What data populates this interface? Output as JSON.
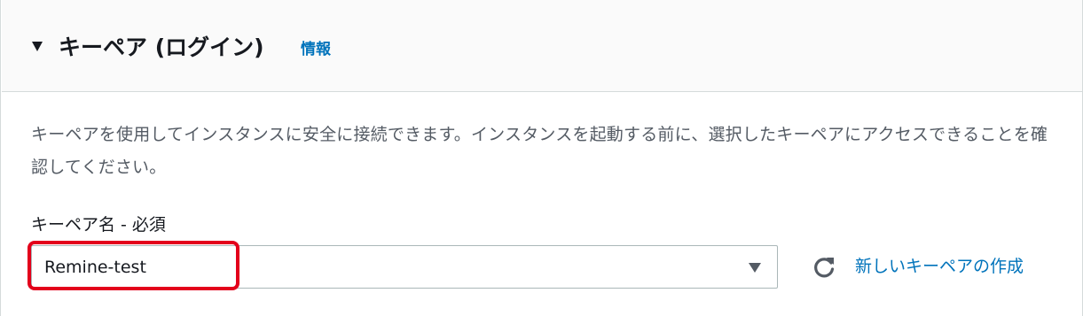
{
  "section": {
    "title": "キーペア (ログイン)",
    "info_link": "情報",
    "description": "キーペアを使用してインスタンスに安全に接続できます。インスタンスを起動する前に、選択したキーペアにアクセスできることを確認してください。"
  },
  "key_pair_field": {
    "label": "キーペア名 - 必須",
    "selected_value": "Remine-test"
  },
  "actions": {
    "create_link": "新しいキーペアの作成"
  },
  "icons": {
    "collapse": "caret-down-icon",
    "dropdown": "chevron-down-icon",
    "refresh": "refresh-icon"
  },
  "colors": {
    "link": "#0073bb",
    "highlight": "#e3001b",
    "header_bg": "#fafafa",
    "border": "#d5dbdb"
  }
}
